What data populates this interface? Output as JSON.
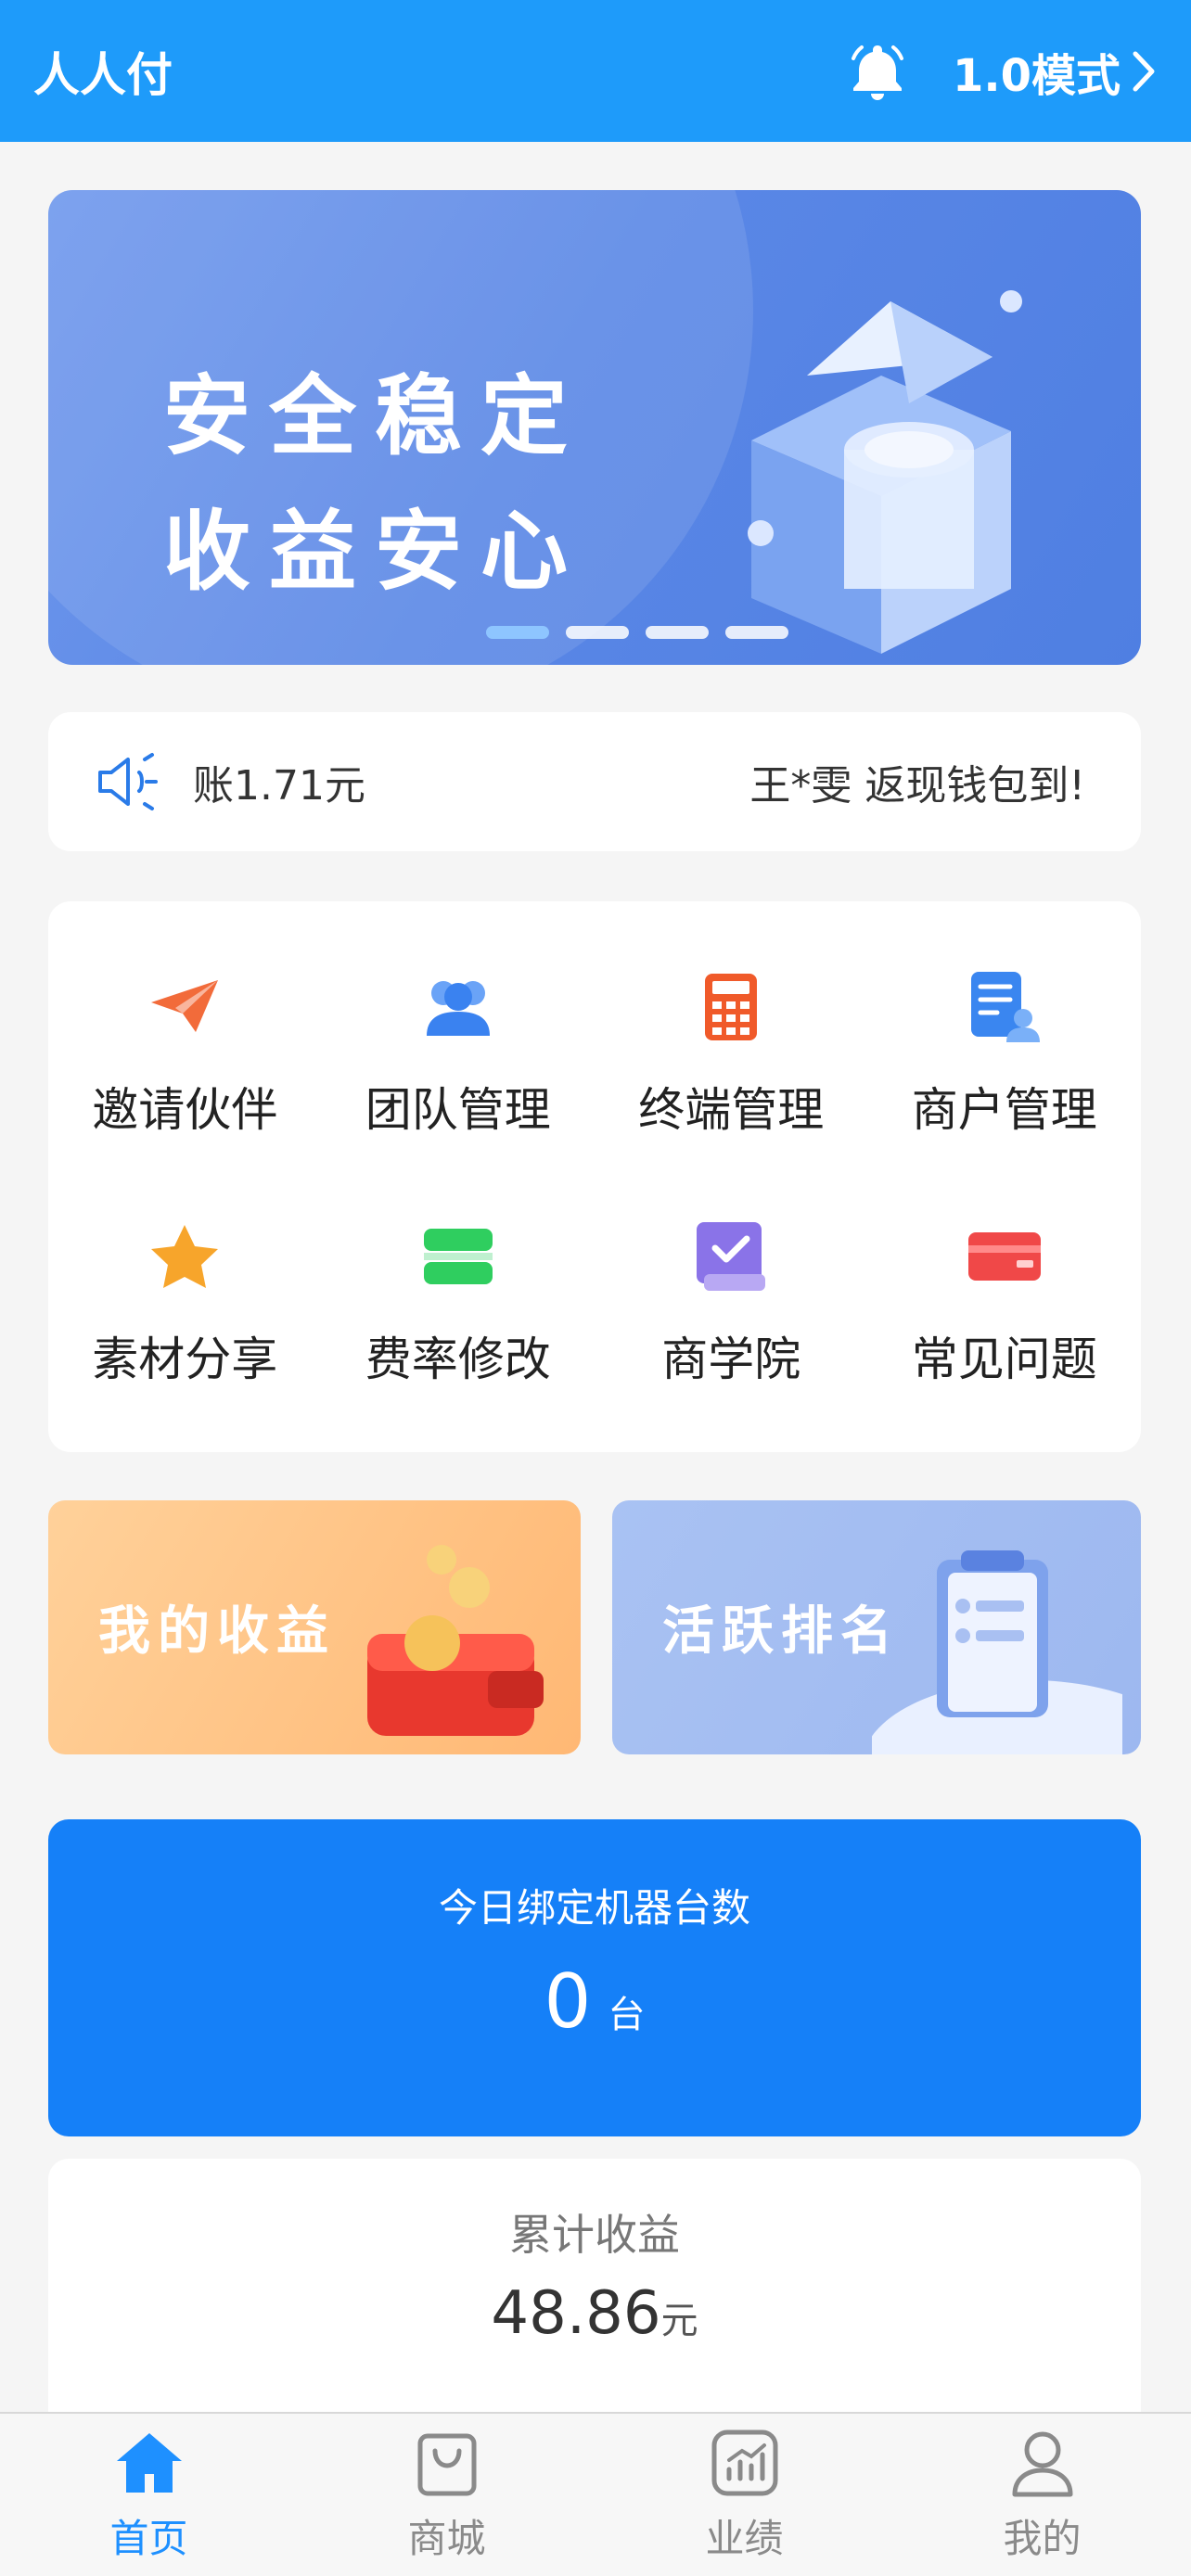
{
  "header": {
    "app_title": "人人付",
    "mode_label": "1.0模式",
    "bell_icon": "bell-icon",
    "chevron_icon": "chevron-right-icon"
  },
  "banner": {
    "line1": "安全稳定",
    "line2": "收益安心",
    "slides_total": 4,
    "active_slide": 1
  },
  "notice": {
    "icon": "speaker-icon",
    "text1": "账1.71元",
    "text2": "王*雯 返现钱包到!"
  },
  "menu": {
    "items": [
      {
        "label": "邀请伙伴",
        "icon": "paper-plane-icon",
        "color": "#f26b3a"
      },
      {
        "label": "团队管理",
        "icon": "team-icon",
        "color": "#4a8ef5"
      },
      {
        "label": "终端管理",
        "icon": "calculator-icon",
        "color": "#f05a2a"
      },
      {
        "label": "商户管理",
        "icon": "merchant-doc-icon",
        "color": "#3a86f0"
      },
      {
        "label": "素材分享",
        "icon": "star-icon",
        "color": "#f7a52b"
      },
      {
        "label": "费率修改",
        "icon": "rate-icon",
        "color": "#2fce5f"
      },
      {
        "label": "商学院",
        "icon": "book-icon",
        "color": "#8a73e8"
      },
      {
        "label": "常见问题",
        "icon": "card-icon",
        "color": "#f04848"
      }
    ]
  },
  "promos": {
    "earnings": "我的收益",
    "ranking": "活跃排名"
  },
  "today": {
    "title": "今日绑定机器台数",
    "value": "0",
    "unit": "台"
  },
  "cumulative": {
    "title": "累计收益",
    "value": "48.86",
    "unit": "元"
  },
  "tabbar": {
    "tabs": [
      {
        "label": "首页",
        "icon": "home-icon",
        "active": true
      },
      {
        "label": "商城",
        "icon": "shopping-bag-icon",
        "active": false
      },
      {
        "label": "业绩",
        "icon": "chart-icon",
        "active": false
      },
      {
        "label": "我的",
        "icon": "user-icon",
        "active": false
      }
    ]
  },
  "colors": {
    "header_bg": "#1e9bfa",
    "accent": "#1580f8",
    "tab_active": "#1e90ff"
  }
}
